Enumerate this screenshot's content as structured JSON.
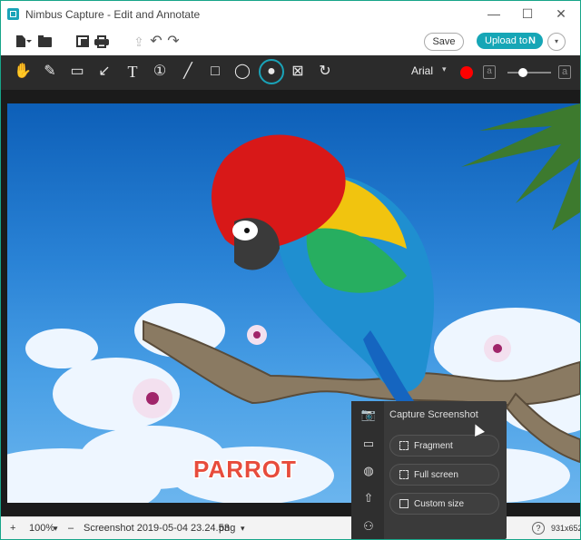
{
  "window": {
    "title": "Nimbus Capture - Edit and Annotate",
    "minimize_label": "—",
    "maximize_label": "☐",
    "close_label": "✕"
  },
  "toolbar": {
    "save_label": "Save",
    "upload_label": "Upload to",
    "upload_brand_mark": "N",
    "more_label": "▾"
  },
  "draw_tools": {
    "font": "Arial",
    "font_caret": "▾",
    "text_size_small": "a",
    "text_size_large": "a",
    "active_color": "#ff0000",
    "stroke_level": 0.35,
    "glyphs": [
      "✋",
      "✎",
      "▭",
      "↙",
      "T",
      "①",
      "╱",
      "□",
      "◯",
      "💧",
      "⊠",
      "↻"
    ]
  },
  "image": {
    "logo_text": "PARROT"
  },
  "statusbar": {
    "zoom_in": "+",
    "zoom": "100%",
    "zoom_out": "–",
    "filename": "Screenshot 2019-05-04 23.24.53",
    "format": "png",
    "help": "?",
    "dimensions": "931x652"
  },
  "capture_menu": {
    "title": "Capture Screenshot",
    "items": [
      {
        "label": "Fragment"
      },
      {
        "label": "Full screen"
      },
      {
        "label": "Custom size"
      }
    ]
  },
  "colors": {
    "accent": "#16a6b6",
    "toolbar_dark": "#2b2b2b",
    "border": "#17a589"
  }
}
